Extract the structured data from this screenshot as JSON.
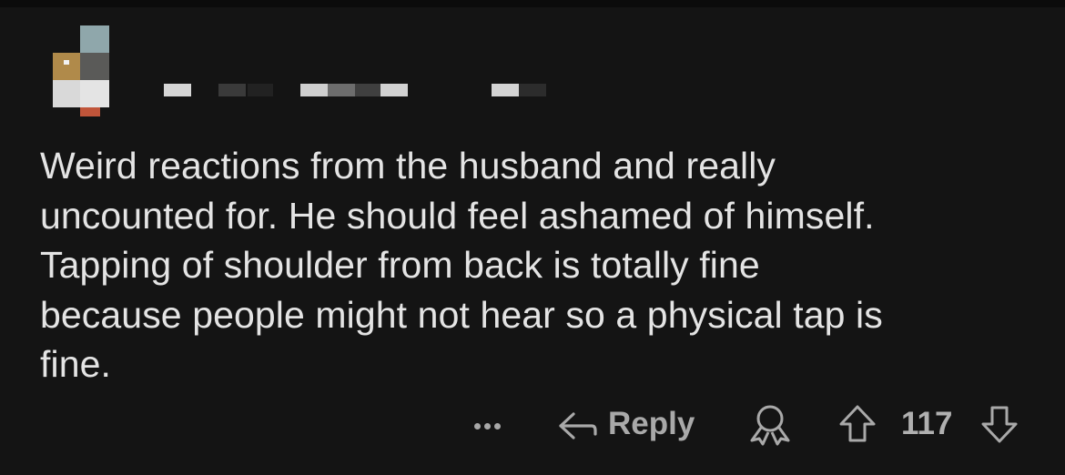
{
  "comment": {
    "body_lines": [
      "Weird reactions from the husband and really",
      "uncounted for. He should feel ashamed of himself.",
      "Tapping of shoulder from back is totally fine",
      "because people might not hear so a physical tap is",
      "fine."
    ]
  },
  "actions": {
    "more_icon": "ellipsis-icon",
    "reply_icon": "reply-arrow-icon",
    "reply_label": "Reply",
    "award_icon": "award-icon",
    "upvote_icon": "upvote-arrow-icon",
    "score": "117",
    "downvote_icon": "downvote-arrow-icon"
  },
  "colors": {
    "background": "#141414",
    "text": "#e4e4e4",
    "muted": "#a9a9a9"
  }
}
